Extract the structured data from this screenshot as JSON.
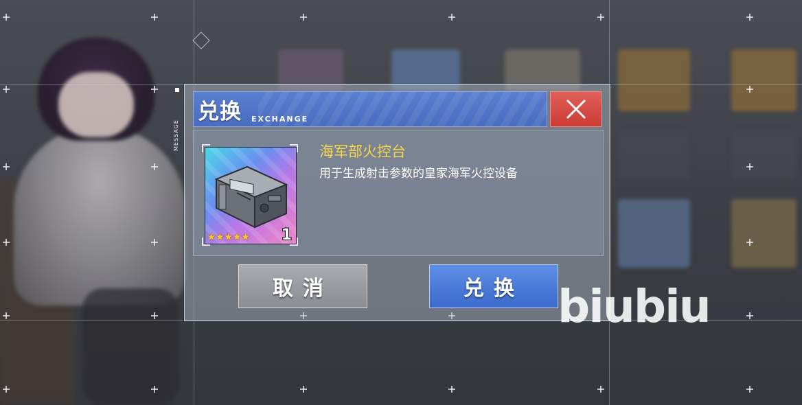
{
  "background": {
    "message_label": "MESSAGE"
  },
  "dialog": {
    "title": "兑换",
    "subtitle": "EXCHANGE",
    "close_icon": "close-icon"
  },
  "item": {
    "name": "海军部火控台",
    "description": "用于生成射击参数的皇家海军火控设备",
    "count": "1",
    "rarity_stars": 5
  },
  "buttons": {
    "cancel_label": "取消",
    "confirm_label": "兑换"
  },
  "watermark": "biubiu",
  "colors": {
    "header_blue": "#4a6cc0",
    "close_red": "#cc3b36",
    "item_name_yellow": "#f7d64c",
    "confirm_blue": "#3b6bcd"
  }
}
